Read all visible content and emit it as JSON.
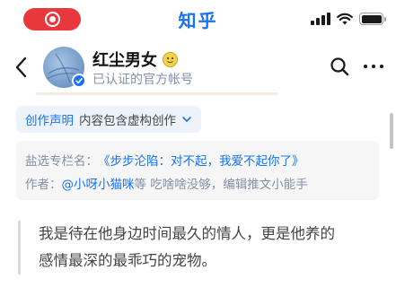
{
  "status_bar": {
    "app_name": "知乎",
    "signal_bars": 4,
    "battery_level": 1.0
  },
  "header": {
    "author_name": "红尘男女",
    "author_subtitle": "已认证的官方帐号",
    "icons": [
      "back-icon",
      "verified-badge-icon",
      "emoji-icon",
      "search-icon",
      "more-icon"
    ]
  },
  "statement": {
    "label": "创作声明",
    "value": "内容包含虚构创作"
  },
  "meta": {
    "column_label": "盐选专栏名：",
    "column_value": "《步步沦陷：对不起，我爱不起你了》",
    "author_label": "作者：",
    "author_value": "@小呀小猫咪",
    "author_suffix": "等 吃啥啥没够，编辑推文小能手"
  },
  "quote": {
    "line1": "我是待在他身边时间最久的情人，更是他养的",
    "line2": "感情最深的最乖巧的宠物。"
  },
  "colors": {
    "brand_blue": "#1772f6",
    "record_red": "#e8383d"
  }
}
